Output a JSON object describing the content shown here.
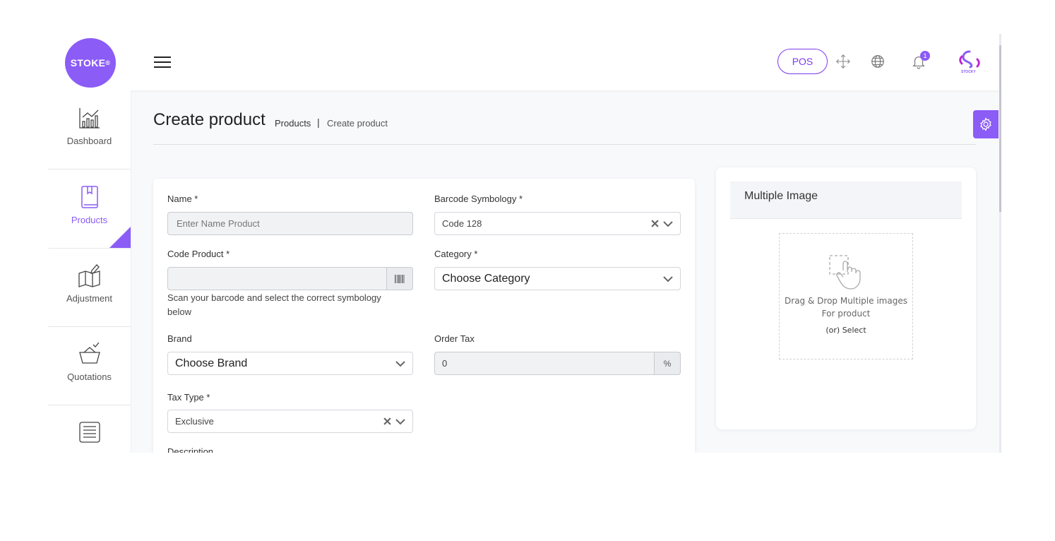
{
  "header": {
    "logo_text": "STOKE",
    "logo_mark": "®",
    "pos_label": "POS",
    "notification_count": "1",
    "avatar_text": "STOCKY",
    "icons": [
      "menu-icon",
      "fullscreen-icon",
      "globe-icon",
      "bell-icon"
    ]
  },
  "sidebar": {
    "items": [
      {
        "label": "Dashboard",
        "icon": "chart-icon"
      },
      {
        "label": "Products",
        "icon": "book-icon",
        "active": true
      },
      {
        "label": "Adjustment",
        "icon": "map-edit-icon"
      },
      {
        "label": "Quotations",
        "icon": "basket-icon"
      },
      {
        "label": "",
        "icon": "receipt-icon"
      }
    ],
    "active_color": "#8b5cf6"
  },
  "page": {
    "title": "Create product",
    "breadcrumb": {
      "parent": "Products",
      "separator": "|",
      "current": "Create product"
    }
  },
  "form": {
    "name": {
      "label": "Name *",
      "placeholder": "Enter Name Product",
      "value": ""
    },
    "barcode_symbology": {
      "label": "Barcode Symbology *",
      "value": "Code 128"
    },
    "code_product": {
      "label": "Code Product *",
      "value": "",
      "hint": "Scan your barcode and select the correct symbology below"
    },
    "category": {
      "label": "Category *",
      "value": "Choose Category"
    },
    "brand": {
      "label": "Brand",
      "value": "Choose Brand"
    },
    "order_tax": {
      "label": "Order Tax",
      "value": "0",
      "suffix": "%"
    },
    "tax_type": {
      "label": "Tax Type *",
      "value": "Exclusive"
    },
    "description": {
      "label": "Description"
    }
  },
  "images": {
    "title": "Multiple Image",
    "drop_text": "Drag & Drop Multiple images For product",
    "select_text": "(or) Select"
  },
  "colors": {
    "accent": "#8b5cf6"
  }
}
